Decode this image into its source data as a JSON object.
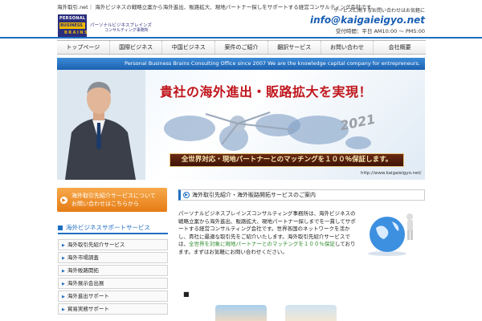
{
  "header": {
    "tagline": "海外取引.net｜ 海外ビジネスの戦略立案から海外進出、販路拡大、現地パートナー探しをサポートする経営コンサルティング会社です。",
    "logo": {
      "line1": "PERSONAL",
      "line2": "BUSINESS",
      "line3": "BRAINS",
      "jp1": "パーソナルビジネスブレインズ",
      "jp2": "コンサルティング事務所"
    },
    "contact_label": "サービスに関するお問い合わせはお気軽に",
    "contact_email": "info@kaigaieigyo.net",
    "contact_hours": "受付時間：平日 AM10:00 ～ PM5:00"
  },
  "nav": {
    "items": [
      "トップページ",
      "国際ビジネス",
      "中国ビジネス",
      "案件のご紹介",
      "翻訳サービス",
      "お問い合わせ",
      "会社概要"
    ]
  },
  "hero": {
    "banner": "Personal Business Brains Consulting Office since 2007  We are the knowledge capital company for entrepreneurs.",
    "headline": "貴社の海外進出・販路拡大を実現！",
    "year": "2021",
    "bar": "全世界対応・現地パートナーとのマッチングを１００％保証します。",
    "url": "http://www.kaigaieigyo.net/"
  },
  "sidebar": {
    "cta_line1": "海外取引先紹介サービスについて",
    "cta_line2": "お問い合わせはこちらから",
    "heading": "海外ビジネスサポートサービス",
    "items": [
      "海外取引先紹介サービス",
      "海外市場調査",
      "海外販路開拓",
      "海外展示会出展",
      "海外進出サポート",
      "貿易実務サポート",
      "翻訳・通訳サービス"
    ]
  },
  "main": {
    "heading": "海外取引先紹介・海外販路開拓サービスのご案内",
    "body": "パーソナルビジネスブレインズコンサルティング事務所は、海外ビジネスの戦略立案から海外進出、販路拡大、現地パートナー探しまでを一貫してサポートする経営コンサルティング会社です。世界各国のネットワークを活かし、貴社に最適な取引先をご紹介いたします。海外取引先紹介サービスでは、",
    "highlight": "全世界を対象に現地パートナーとのマッチングを１００％保証",
    "body_end": "しております。まずはお気軽にお問い合わせください。",
    "bullet": "■"
  }
}
